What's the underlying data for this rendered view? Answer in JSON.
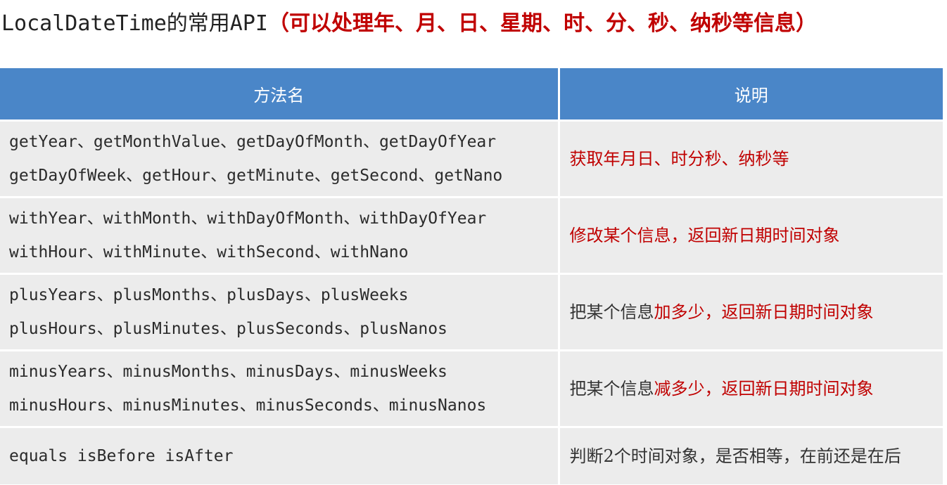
{
  "title": {
    "prefix": "LocalDateTime的常用API",
    "highlight": "（可以处理年、月、日、星期、时、分、秒、纳秒等信息）"
  },
  "table": {
    "headers": [
      "方法名",
      "说明"
    ],
    "rows": [
      {
        "methods": [
          "getYear、getMonthValue、getDayOfMonth、getDayOfYear",
          "getDayOfWeek、getHour、getMinute、getSecond、getNano"
        ],
        "desc_normal": "",
        "desc_red": "获取年月日、时分秒、纳秒等",
        "desc_rest": ""
      },
      {
        "methods": [
          "withYear、withMonth、withDayOfMonth、withDayOfYear",
          "withHour、withMinute、withSecond、withNano"
        ],
        "desc_normal": "",
        "desc_red": "修改某个信息，返回新日期时间对象",
        "desc_rest": ""
      },
      {
        "methods": [
          "plusYears、plusMonths、plusDays、plusWeeks",
          "plusHours、plusMinutes、plusSeconds、plusNanos"
        ],
        "desc_normal": "把某个信息",
        "desc_red": "加多少，返回新日期时间对象",
        "desc_rest": ""
      },
      {
        "methods": [
          "minusYears、minusMonths、minusDays、minusWeeks",
          "minusHours、minusMinutes、minusSeconds、minusNanos"
        ],
        "desc_normal": "把某个信息",
        "desc_red": "减多少，返回新日期时间对象",
        "desc_rest": ""
      },
      {
        "methods": [
          "equals isBefore isAfter"
        ],
        "desc_normal": "判断2个时间对象，是否相等，在前还是在后",
        "desc_red": "",
        "desc_rest": ""
      }
    ]
  }
}
